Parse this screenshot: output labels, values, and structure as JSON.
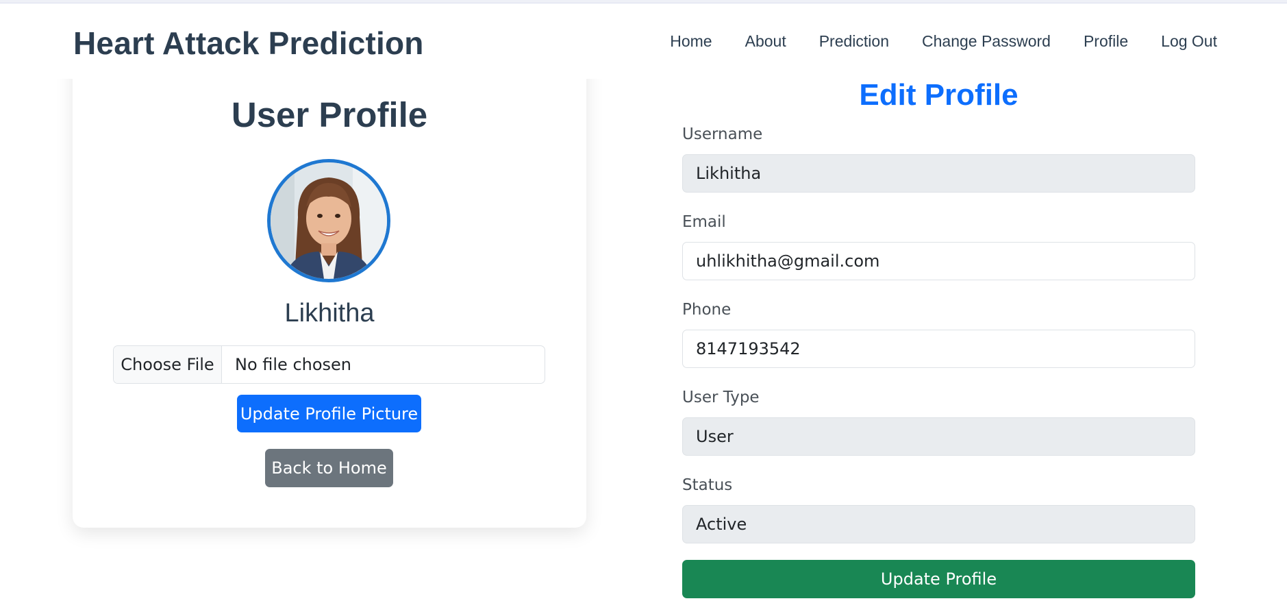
{
  "navbar": {
    "brand": "Heart Attack Prediction",
    "links": [
      "Home",
      "About",
      "Prediction",
      "Change Password",
      "Profile",
      "Log Out"
    ]
  },
  "profile_card": {
    "title": "User Profile",
    "avatar_icon": "user-photo",
    "username": "Likhitha",
    "file_button": "Choose File",
    "file_status": "No file chosen",
    "update_picture_label": "Update Profile Picture",
    "back_label": "Back to Home"
  },
  "edit_form": {
    "title": "Edit Profile",
    "fields": [
      {
        "label": "Username",
        "value": "Likhitha",
        "readonly": true
      },
      {
        "label": "Email",
        "value": "uhlikhitha@gmail.com",
        "readonly": false
      },
      {
        "label": "Phone",
        "value": "8147193542",
        "readonly": false
      },
      {
        "label": "User Type",
        "value": "User",
        "readonly": true
      },
      {
        "label": "Status",
        "value": "Active",
        "readonly": true
      }
    ],
    "submit_label": "Update Profile"
  },
  "colors": {
    "brand_text": "#2c3e50",
    "primary": "#0d6efd",
    "secondary": "#6c757d",
    "success": "#198754",
    "readonly_bg": "#e9ecef",
    "avatar_border": "#1f78d1"
  }
}
